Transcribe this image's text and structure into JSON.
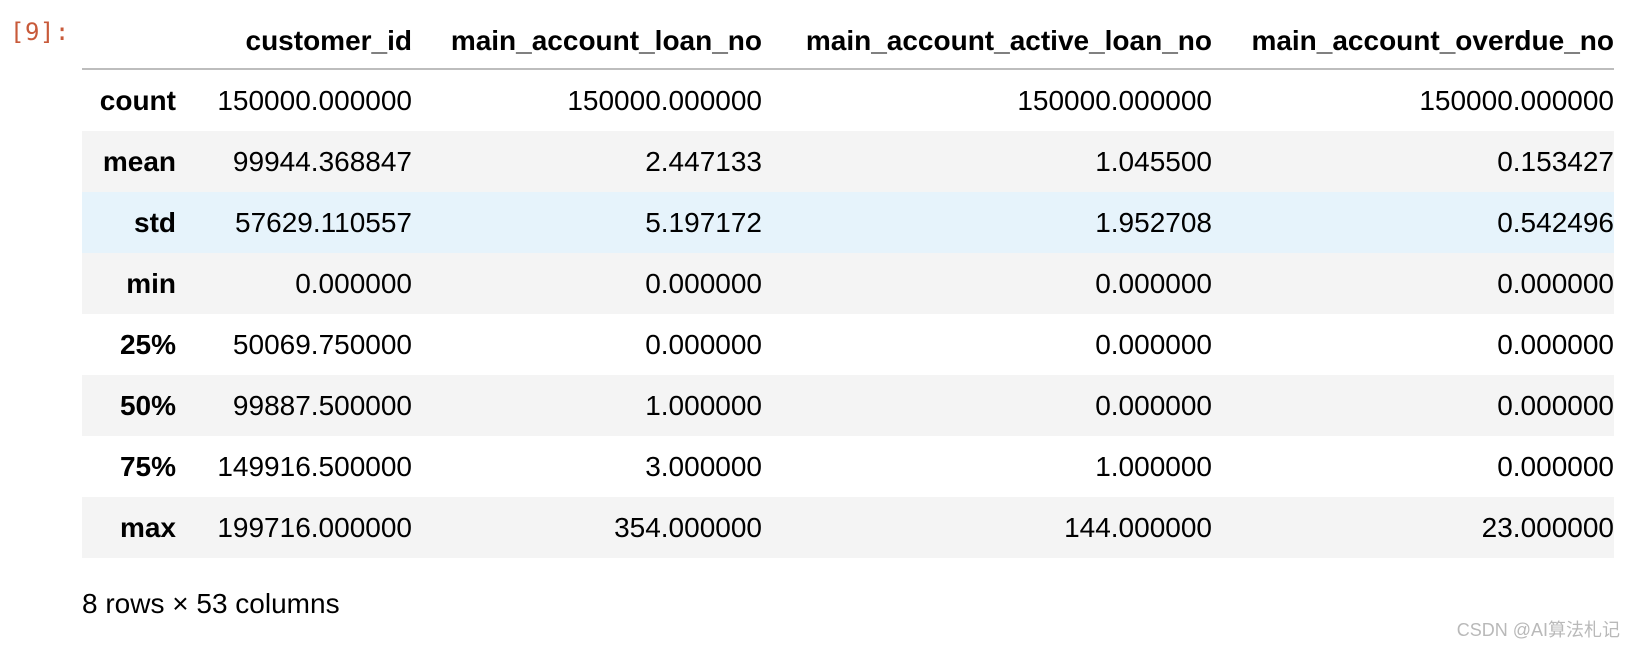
{
  "cell": {
    "prompt": "[9]:"
  },
  "table": {
    "columns": [
      "",
      "customer_id",
      "main_account_loan_no",
      "main_account_active_loan_no",
      "main_account_overdue_no"
    ],
    "rows": [
      {
        "index": "count",
        "values": [
          "150000.000000",
          "150000.000000",
          "150000.000000",
          "150000.000000"
        ]
      },
      {
        "index": "mean",
        "values": [
          "99944.368847",
          "2.447133",
          "1.045500",
          "0.153427"
        ]
      },
      {
        "index": "std",
        "values": [
          "57629.110557",
          "5.197172",
          "1.952708",
          "0.542496"
        ]
      },
      {
        "index": "min",
        "values": [
          "0.000000",
          "0.000000",
          "0.000000",
          "0.000000"
        ]
      },
      {
        "index": "25%",
        "values": [
          "50069.750000",
          "0.000000",
          "0.000000",
          "0.000000"
        ]
      },
      {
        "index": "50%",
        "values": [
          "99887.500000",
          "1.000000",
          "0.000000",
          "0.000000"
        ]
      },
      {
        "index": "75%",
        "values": [
          "149916.500000",
          "3.000000",
          "1.000000",
          "0.000000"
        ]
      },
      {
        "index": "max",
        "values": [
          "199716.000000",
          "354.000000",
          "144.000000",
          "23.000000"
        ]
      }
    ]
  },
  "shape_text": "8 rows × 53 columns",
  "watermark": "CSDN @AI算法札记",
  "colors": {
    "prompt": "#c85a3a",
    "row_alt": "#f4f4f4",
    "row_hover": "#e6f3fb"
  }
}
